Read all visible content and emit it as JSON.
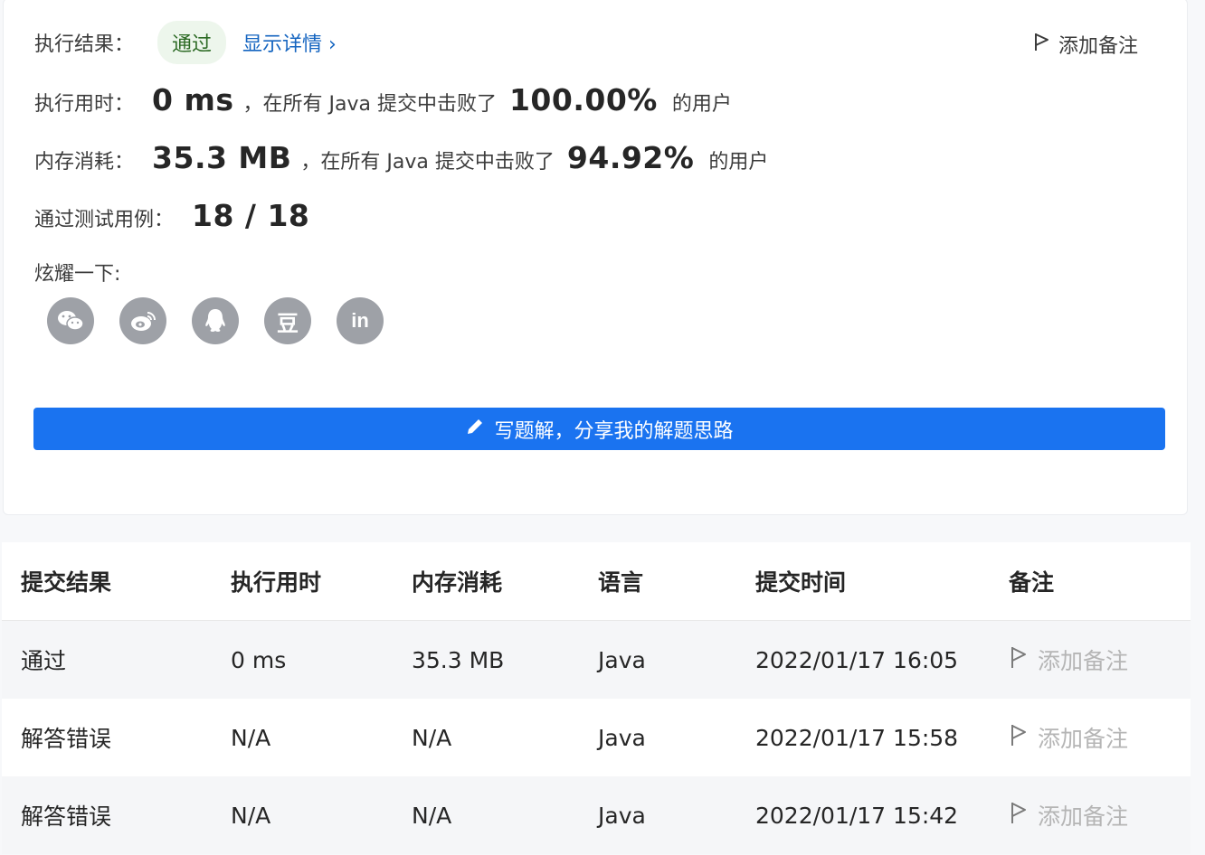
{
  "result": {
    "label": "执行结果：",
    "status": "通过",
    "detail_link": "显示详情 ›",
    "add_note": "添加备注"
  },
  "runtime": {
    "label": "执行用时：",
    "value": "0 ms",
    "text_mid": "，在所有 Java 提交中击败了",
    "percent": "100.00%",
    "text_end": "的用户"
  },
  "memory": {
    "label": "内存消耗：",
    "value": "35.3 MB",
    "text_mid": "，在所有 Java 提交中击败了",
    "percent": "94.92%",
    "text_end": "的用户"
  },
  "testcases": {
    "label": "通过测试用例：",
    "value": "18 / 18"
  },
  "share": {
    "label": "炫耀一下:",
    "icons": [
      "wechat-icon",
      "weibo-icon",
      "qq-icon",
      "douban-icon",
      "linkedin-icon"
    ],
    "douban_glyph": "豆",
    "linkedin_glyph": "in"
  },
  "write_solution_label": "写题解，分享我的解题思路",
  "colors": {
    "primary": "#1a73f0",
    "pass": "#3aad2e",
    "fail": "#f2333a",
    "badge_bg": "#edf6ec"
  },
  "submissions": {
    "headers": [
      "提交结果",
      "执行用时",
      "内存消耗",
      "语言",
      "提交时间",
      "备注"
    ],
    "rows": [
      {
        "result": "通过",
        "runtime": "0 ms",
        "memory": "35.3 MB",
        "lang": "Java",
        "time": "2022/01/17 16:05",
        "note": "添加备注"
      },
      {
        "result": "解答错误",
        "runtime": "N/A",
        "memory": "N/A",
        "lang": "Java",
        "time": "2022/01/17 15:58",
        "note": "添加备注"
      },
      {
        "result": "解答错误",
        "runtime": "N/A",
        "memory": "N/A",
        "lang": "Java",
        "time": "2022/01/17 15:42",
        "note": "添加备注"
      }
    ]
  }
}
